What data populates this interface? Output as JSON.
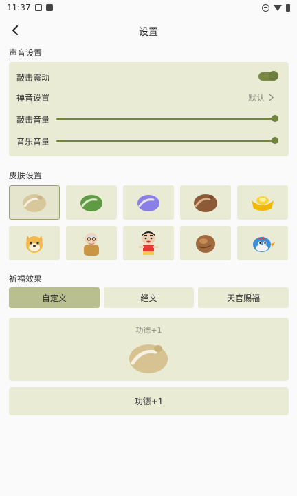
{
  "status_bar": {
    "time": "11:37"
  },
  "header": {
    "title": "设置"
  },
  "sound": {
    "section_label": "声音设置",
    "vibration_label": "敲击震动",
    "vibration_on": true,
    "zen_label": "禅音设置",
    "zen_value": "默认",
    "knock_volume_label": "敲击音量",
    "knock_volume": 1.0,
    "music_volume_label": "音乐音量",
    "music_volume": 1.0,
    "accent_color": "#6f843f"
  },
  "skins": {
    "section_label": "皮肤设置",
    "items": [
      {
        "icon": "wooden-fish-beige-icon",
        "selected": true
      },
      {
        "icon": "wooden-fish-green-icon",
        "selected": false
      },
      {
        "icon": "wooden-fish-purple-icon",
        "selected": false
      },
      {
        "icon": "wooden-fish-brown-icon",
        "selected": false
      },
      {
        "icon": "gold-ingot-icon",
        "selected": false
      },
      {
        "icon": "dog-icon",
        "selected": false
      },
      {
        "icon": "old-man-icon",
        "selected": false
      },
      {
        "icon": "cartoon-boy-icon",
        "selected": false
      },
      {
        "icon": "round-fish-icon",
        "selected": false
      },
      {
        "icon": "blue-bird-icon",
        "selected": false
      }
    ]
  },
  "blessing": {
    "section_label": "祈福效果",
    "tabs": [
      {
        "label": "自定义",
        "active": true
      },
      {
        "label": "经文",
        "active": false
      },
      {
        "label": "天官赐福",
        "active": false
      }
    ],
    "preview_text": "功德+1",
    "button_text": "功德+1"
  }
}
